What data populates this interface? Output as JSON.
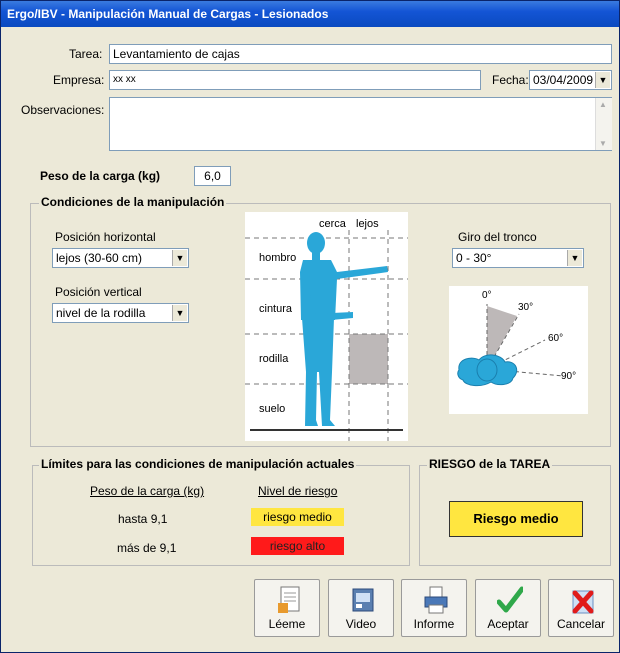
{
  "window": {
    "title": "Ergo/IBV - Manipulación Manual de Cargas - Lesionados"
  },
  "form": {
    "tarea_label": "Tarea:",
    "tarea_value": "Levantamiento de cajas",
    "empresa_label": "Empresa:",
    "empresa_value": "xx xx",
    "fecha_label": "Fecha:",
    "fecha_value": "03/04/2009",
    "observaciones_label": "Observaciones:",
    "observaciones_value": "",
    "peso_label": "Peso de la carga (kg)",
    "peso_value": "6,0"
  },
  "conditions": {
    "title": "Condiciones de la manipulación",
    "pos_horizontal_label": "Posición horizontal",
    "pos_horizontal_value": "lejos (30-60 cm)",
    "pos_vertical_label": "Posición vertical",
    "pos_vertical_value": "nivel de la rodilla",
    "giro_label": "Giro del tronco",
    "giro_value": "0 - 30°",
    "figure": {
      "cerca": "cerca",
      "lejos": "lejos",
      "hombro": "hombro",
      "cintura": "cintura",
      "rodilla": "rodilla",
      "suelo": "suelo"
    },
    "angles": {
      "a0": "0°",
      "a30": "30°",
      "a60": "60°",
      "a90": "90°"
    }
  },
  "limits": {
    "title": "Límites para las condiciones de manipulación actuales",
    "col_peso": "Peso de la carga (kg)",
    "col_nivel": "Nivel de riesgo",
    "rows": [
      {
        "peso": "hasta 9,1",
        "nivel": "riesgo medio",
        "color": "#ffe640"
      },
      {
        "peso": "más de 9,1",
        "nivel": "riesgo alto",
        "color": "#ff1a1a"
      }
    ]
  },
  "risk": {
    "title": "RIESGO de la TAREA",
    "value": "Riesgo medio",
    "color": "#ffe640"
  },
  "toolbar": {
    "leeme": "Léeme",
    "video": "Video",
    "informe": "Informe",
    "aceptar": "Aceptar",
    "cancelar": "Cancelar"
  }
}
